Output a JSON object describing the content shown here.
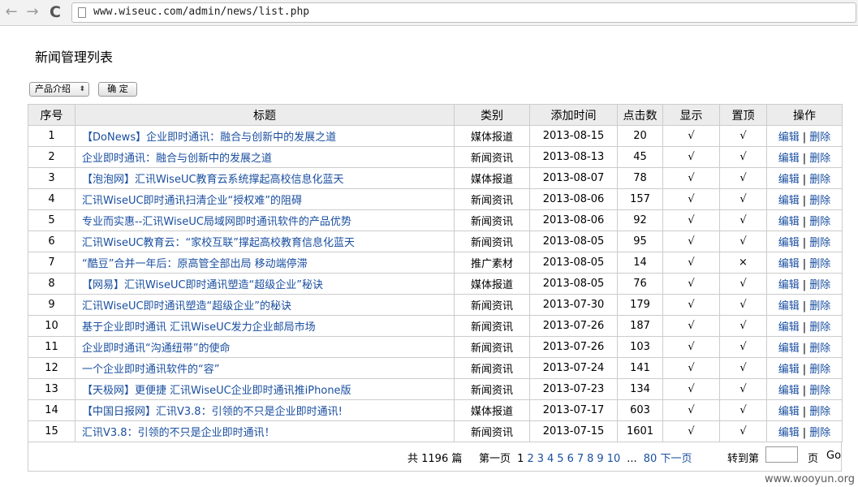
{
  "browser": {
    "url": "www.wiseuc.com/admin/news/list.php",
    "back_icon": "←",
    "forward_icon": "→",
    "reload_icon": "C"
  },
  "page": {
    "title": "新闻管理列表",
    "filter": {
      "selected": "产品介绍",
      "confirm_label": "确 定"
    }
  },
  "table": {
    "headers": [
      "序号",
      "标题",
      "类别",
      "添加时间",
      "点击数",
      "显示",
      "置顶",
      "操作"
    ],
    "edit_label": "编辑",
    "delete_label": "删除",
    "separator": "|",
    "rows": [
      {
        "no": "1",
        "title": "【DoNews】企业即时通讯：融合与创新中的发展之道",
        "category": "媒体报道",
        "date": "2013-08-15",
        "clicks": "20",
        "show": "√",
        "top": "√"
      },
      {
        "no": "2",
        "title": "企业即时通讯：融合与创新中的发展之道",
        "category": "新闻资讯",
        "date": "2013-08-13",
        "clicks": "45",
        "show": "√",
        "top": "√"
      },
      {
        "no": "3",
        "title": "【泡泡网】汇讯WiseUC教育云系统撑起高校信息化蓝天",
        "category": "媒体报道",
        "date": "2013-08-07",
        "clicks": "78",
        "show": "√",
        "top": "√"
      },
      {
        "no": "4",
        "title": "汇讯WiseUC即时通讯扫清企业“授权难”的阻碍",
        "category": "新闻资讯",
        "date": "2013-08-06",
        "clicks": "157",
        "show": "√",
        "top": "√"
      },
      {
        "no": "5",
        "title": "专业而实惠--汇讯WiseUC局域网即时通讯软件的产品优势",
        "category": "新闻资讯",
        "date": "2013-08-06",
        "clicks": "92",
        "show": "√",
        "top": "√"
      },
      {
        "no": "6",
        "title": "汇讯WiseUC教育云：“家校互联”撑起高校教育信息化蓝天",
        "category": "新闻资讯",
        "date": "2013-08-05",
        "clicks": "95",
        "show": "√",
        "top": "√"
      },
      {
        "no": "7",
        "title": "“酷豆”合并一年后：原高管全部出局 移动端停滞",
        "category": "推广素材",
        "date": "2013-08-05",
        "clicks": "14",
        "show": "√",
        "top": "×"
      },
      {
        "no": "8",
        "title": "【网易】汇讯WiseUC即时通讯塑造“超级企业”秘诀",
        "category": "媒体报道",
        "date": "2013-08-05",
        "clicks": "76",
        "show": "√",
        "top": "√"
      },
      {
        "no": "9",
        "title": "汇讯WiseUC即时通讯塑造“超级企业”的秘诀",
        "category": "新闻资讯",
        "date": "2013-07-30",
        "clicks": "179",
        "show": "√",
        "top": "√"
      },
      {
        "no": "10",
        "title": "基于企业即时通讯 汇讯WiseUC发力企业邮局市场",
        "category": "新闻资讯",
        "date": "2013-07-26",
        "clicks": "187",
        "show": "√",
        "top": "√"
      },
      {
        "no": "11",
        "title": "企业即时通讯“沟通纽带”的使命",
        "category": "新闻资讯",
        "date": "2013-07-26",
        "clicks": "103",
        "show": "√",
        "top": "√"
      },
      {
        "no": "12",
        "title": "一个企业即时通讯软件的“容”",
        "category": "新闻资讯",
        "date": "2013-07-24",
        "clicks": "141",
        "show": "√",
        "top": "√"
      },
      {
        "no": "13",
        "title": "【天极网】更便捷 汇讯WiseUC企业即时通讯推iPhone版",
        "category": "新闻资讯",
        "date": "2013-07-23",
        "clicks": "134",
        "show": "√",
        "top": "√"
      },
      {
        "no": "14",
        "title": "【中国日报网】汇讯V3.8：引领的不只是企业即时通讯!",
        "category": "媒体报道",
        "date": "2013-07-17",
        "clicks": "603",
        "show": "√",
        "top": "√"
      },
      {
        "no": "15",
        "title": "汇讯V3.8：引领的不只是企业即时通讯！",
        "category": "新闻资讯",
        "date": "2013-07-15",
        "clicks": "1601",
        "show": "√",
        "top": "√"
      }
    ]
  },
  "pager": {
    "total": "共 1196 篇",
    "first": "第一页",
    "current": "1",
    "pages": [
      "2",
      "3",
      "4",
      "5",
      "6",
      "7",
      "8",
      "9",
      "10"
    ],
    "ellipsis": "...",
    "last": "80",
    "next": "下一页",
    "goto_label": "转到第",
    "unit": "页",
    "go": "Go"
  },
  "watermark": "www.wooyun.org"
}
